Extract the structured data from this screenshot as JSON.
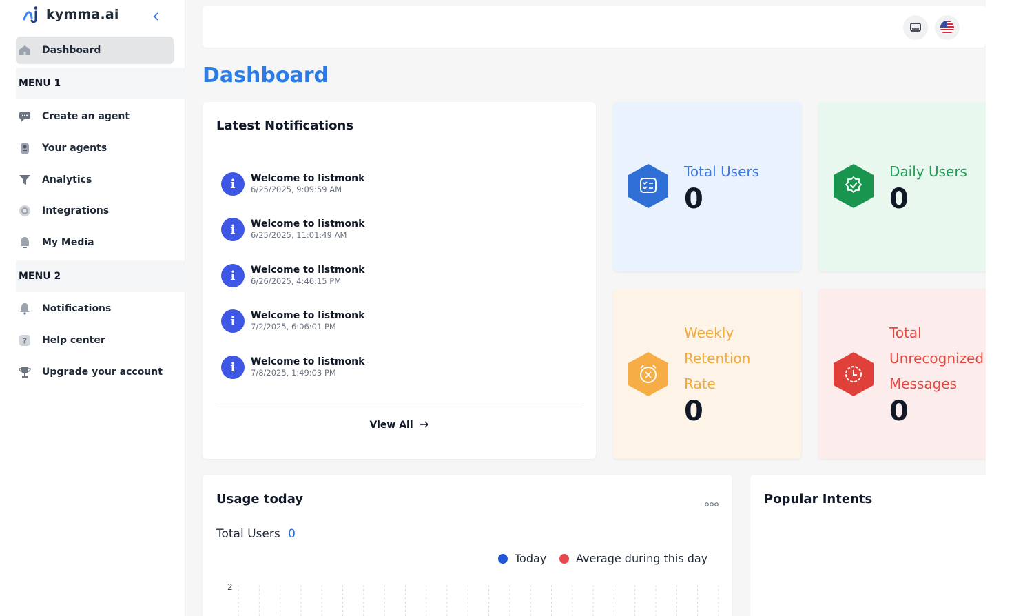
{
  "brand": {
    "name": "kymma.ai"
  },
  "sidebar": {
    "dashboard": "Dashboard",
    "menu1": "MENU 1",
    "menu1_items": [
      "Create an agent",
      "Your agents",
      "Analytics",
      "Integrations",
      "My Media"
    ],
    "menu2": "MENU 2",
    "menu2_items": [
      "Notifications",
      "Help center",
      "Upgrade your account"
    ]
  },
  "page": {
    "title": "Dashboard"
  },
  "notifications": {
    "title": "Latest Notifications",
    "items": [
      {
        "title": "Welcome to listmonk",
        "time": "6/25/2025, 9:09:59 AM"
      },
      {
        "title": "Welcome to listmonk",
        "time": "6/25/2025, 11:01:49 AM"
      },
      {
        "title": "Welcome to listmonk",
        "time": "6/26/2025, 4:46:15 PM"
      },
      {
        "title": "Welcome to listmonk",
        "time": "7/2/2025, 6:06:01 PM"
      },
      {
        "title": "Welcome to listmonk",
        "time": "7/8/2025, 1:49:03 PM"
      }
    ],
    "view_all": "View All"
  },
  "stats": {
    "total_users": {
      "label": "Total Users",
      "value": "0",
      "color": "#3b78e7",
      "bg": "#eaf2fd"
    },
    "daily_users": {
      "label": "Daily Users",
      "value": "0",
      "color": "#1f9d55",
      "bg": "#e9f8ef"
    },
    "weekly_retention": {
      "label_lines": [
        "Weekly",
        "Retention",
        "Rate"
      ],
      "value": "0",
      "color": "#f0a93b",
      "bg": "#fdf3e6"
    },
    "unrecognized": {
      "label_lines": [
        "Total",
        "Unrecognized",
        "Messages"
      ],
      "value": "0",
      "color": "#e5483f",
      "bg": "#fdecec"
    }
  },
  "usage": {
    "title": "Usage today",
    "metric_label": "Total Users",
    "metric_value": "0",
    "legend": [
      {
        "name": "Today",
        "color": "#2256d8"
      },
      {
        "name": "Average during this day",
        "color": "#e5484d"
      }
    ],
    "y_tick": "2"
  },
  "popular": {
    "title": "Popular Intents"
  }
}
